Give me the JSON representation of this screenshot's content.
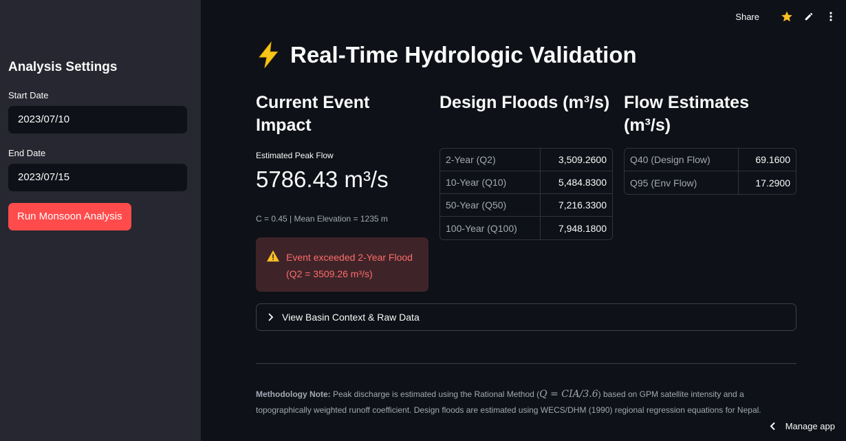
{
  "sidebar": {
    "title": "Analysis Settings",
    "start_date_label": "Start Date",
    "start_date_value": "2023/07/10",
    "end_date_label": "End Date",
    "end_date_value": "2023/07/15",
    "run_button_label": "Run Monsoon Analysis"
  },
  "toolbar": {
    "share_label": "Share",
    "star_icon": "star-icon",
    "edit_icon": "pencil-icon",
    "menu_icon": "more-vertical-icon",
    "star_color": "#fbbf24"
  },
  "main": {
    "title_emoji": "⚡",
    "title": "Real-Time Hydrologic Validation"
  },
  "impact": {
    "heading": "Current Event Impact",
    "metric_label": "Estimated Peak Flow",
    "metric_value": "5786.43 m³/s",
    "caption": "C = 0.45 | Mean Elevation = 1235 m",
    "alert_text": "Event exceeded 2-Year Flood (Q2 = 3509.26 m³/s)",
    "alert_color": "#ff6c6c"
  },
  "design_floods": {
    "heading": "Design Floods (m³/s)",
    "rows": [
      {
        "label": "2-Year (Q2)",
        "value": "3,509.2600"
      },
      {
        "label": "10-Year (Q10)",
        "value": "5,484.8300"
      },
      {
        "label": "50-Year (Q50)",
        "value": "7,216.3300"
      },
      {
        "label": "100-Year (Q100)",
        "value": "7,948.1800"
      }
    ]
  },
  "flow_estimates": {
    "heading": "Flow Estimates (m³/s)",
    "rows": [
      {
        "label": "Q40 (Design Flow)",
        "value": "69.1600"
      },
      {
        "label": "Q95 (Env Flow)",
        "value": "17.2900"
      }
    ]
  },
  "expander": {
    "label": "View Basin Context & Raw Data"
  },
  "note": {
    "bold": "Methodology Note:",
    "text_before": " Peak discharge is estimated using the Rational Method (",
    "formula": "Q = CIA/3.6",
    "text_after": ") based on GPM satellite intensity and a topographically weighted runoff coefficient. Design floods are estimated using WECS/DHM (1990) regional regression equations for Nepal."
  },
  "footer": {
    "manage_label": "Manage app"
  },
  "colors": {
    "background": "#0e1117",
    "sidebar": "#262730",
    "primary": "#ff4b4b"
  }
}
